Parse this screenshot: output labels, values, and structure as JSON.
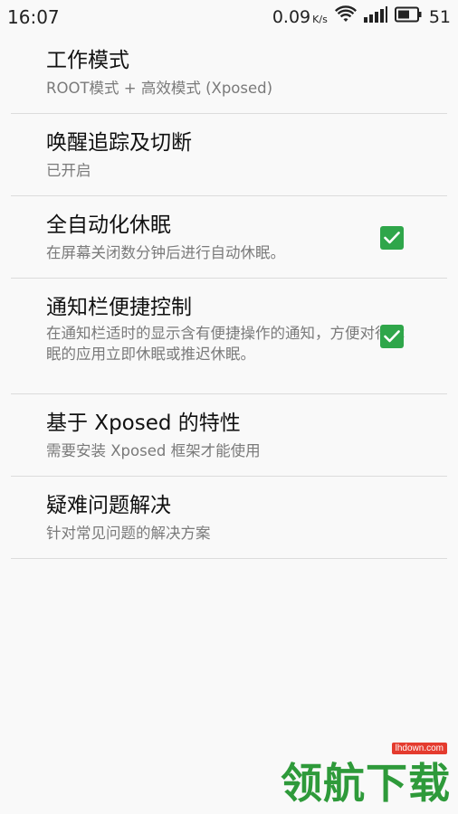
{
  "status_bar": {
    "time": "16:07",
    "speed": "0.09",
    "speed_unit": "K/s",
    "battery": "51"
  },
  "items": [
    {
      "title": "工作模式",
      "subtitle": "ROOT模式 + 高效模式 (Xposed)",
      "checked": null
    },
    {
      "title": "唤醒追踪及切断",
      "subtitle": "已开启",
      "checked": null
    },
    {
      "title": "全自动化休眠",
      "subtitle": "在屏幕关闭数分钟后进行自动休眠。",
      "checked": true
    },
    {
      "title": "通知栏便捷控制",
      "subtitle": "在通知栏适时的显示含有便捷操作的通知，方便对待休眠的应用立即休眠或推迟休眠。",
      "checked": true
    },
    {
      "title": "基于 Xposed 的特性",
      "subtitle": "需要安装 Xposed 框架才能使用",
      "checked": null
    },
    {
      "title": "疑难问题解决",
      "subtitle": "针对常见问题的解决方案",
      "checked": null
    }
  ],
  "watermark": {
    "domain": "lhdown.com",
    "text": "领航下载"
  },
  "colors": {
    "accent": "#2fa64a",
    "divider": "#dcdcdc",
    "background": "#f9f9f9",
    "watermark_green": "#2e9a3a",
    "watermark_red": "#e43b2e"
  }
}
